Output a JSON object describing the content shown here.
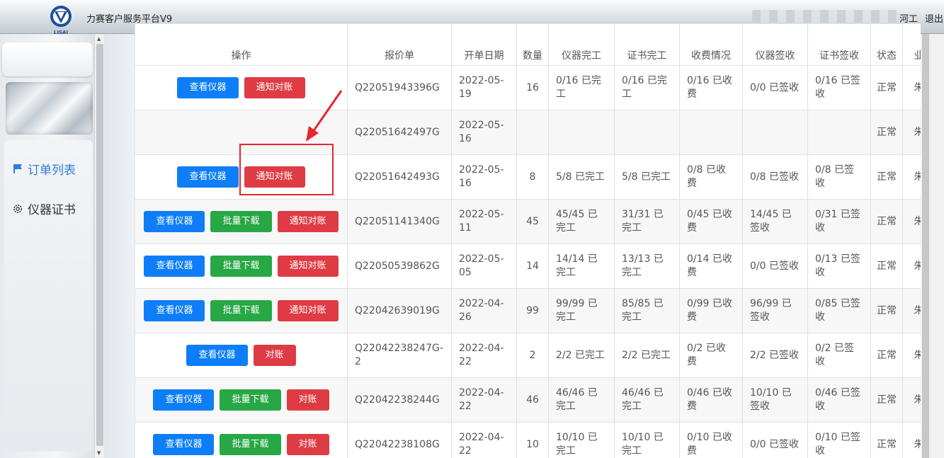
{
  "app": {
    "title": "力赛客户服务平台V9",
    "logo_text": "LISAI",
    "user_name_suffix": "河工",
    "logout_label": "退出"
  },
  "sidebar": {
    "items": [
      {
        "label": "订单列表",
        "icon": "flag-icon",
        "active": true
      },
      {
        "label": "仪器证书",
        "icon": "gear-icon",
        "active": false
      }
    ]
  },
  "table": {
    "headers": [
      "操作",
      "报价单",
      "开单日期",
      "数量",
      "仪器完工",
      "证书完工",
      "收费情况",
      "仪器签收",
      "证书签收",
      "状态",
      "业"
    ],
    "rows": [
      {
        "buttons": [
          {
            "label": "查看仪器",
            "color": "blue"
          },
          {
            "label": "通知对账",
            "color": "red"
          }
        ],
        "quote": "Q22051943396G",
        "date": "2022-05-19",
        "qty": "16",
        "inst_done": "0/16 已完工",
        "cert_done": "0/16 已完工",
        "fee": "0/16 已收费",
        "inst_sign": "0/0 已签收",
        "cert_sign": "0/16 已签收",
        "status": "正常",
        "extra": "朱"
      },
      {
        "buttons": [],
        "quote": "Q22051642497G",
        "date": "2022-05-16",
        "qty": "",
        "inst_done": "",
        "cert_done": "",
        "fee": "",
        "inst_sign": "",
        "cert_sign": "",
        "status": "正常",
        "extra": "朱"
      },
      {
        "buttons": [
          {
            "label": "查看仪器",
            "color": "blue"
          },
          {
            "label": "通知对账",
            "color": "red"
          }
        ],
        "quote": "Q22051642493G",
        "date": "2022-05-16",
        "qty": "8",
        "inst_done": "5/8 已完工",
        "cert_done": "5/8 已完工",
        "fee": "0/8 已收费",
        "inst_sign": "0/8 已签收",
        "cert_sign": "0/8 已签收",
        "status": "正常",
        "extra": "朱"
      },
      {
        "buttons": [
          {
            "label": "查看仪器",
            "color": "blue"
          },
          {
            "label": "批量下载",
            "color": "green"
          },
          {
            "label": "通知对账",
            "color": "red"
          }
        ],
        "quote": "Q22051141340G",
        "date": "2022-05-11",
        "qty": "45",
        "inst_done": "45/45 已完工",
        "cert_done": "31/31 已完工",
        "fee": "0/45 已收费",
        "inst_sign": "14/45 已签收",
        "cert_sign": "0/31 已签收",
        "status": "正常",
        "extra": "朱"
      },
      {
        "buttons": [
          {
            "label": "查看仪器",
            "color": "blue"
          },
          {
            "label": "批量下载",
            "color": "green"
          },
          {
            "label": "通知对账",
            "color": "red"
          }
        ],
        "quote": "Q22050539862G",
        "date": "2022-05-05",
        "qty": "14",
        "inst_done": "14/14 已完工",
        "cert_done": "13/13 已完工",
        "fee": "0/14 已收费",
        "inst_sign": "0/0 已签收",
        "cert_sign": "0/13 已签收",
        "status": "正常",
        "extra": "朱"
      },
      {
        "buttons": [
          {
            "label": "查看仪器",
            "color": "blue"
          },
          {
            "label": "批量下载",
            "color": "green"
          },
          {
            "label": "通知对账",
            "color": "red"
          }
        ],
        "quote": "Q22042639019G",
        "date": "2022-04-26",
        "qty": "99",
        "inst_done": "99/99 已完工",
        "cert_done": "85/85 已完工",
        "fee": "0/99 已收费",
        "inst_sign": "96/99 已签收",
        "cert_sign": "0/85 已签收",
        "status": "正常",
        "extra": "朱"
      },
      {
        "buttons": [
          {
            "label": "查看仪器",
            "color": "blue"
          },
          {
            "label": "对账",
            "color": "red"
          }
        ],
        "quote": "Q22042238247G-2",
        "date": "2022-04-22",
        "qty": "2",
        "inst_done": "2/2 已完工",
        "cert_done": "2/2 已完工",
        "fee": "0/2 已收费",
        "inst_sign": "2/2 已签收",
        "cert_sign": "0/2 已签收",
        "status": "正常",
        "extra": "朱"
      },
      {
        "buttons": [
          {
            "label": "查看仪器",
            "color": "blue"
          },
          {
            "label": "批量下载",
            "color": "green"
          },
          {
            "label": "对账",
            "color": "red"
          }
        ],
        "quote": "Q22042238244G",
        "date": "2022-04-22",
        "qty": "46",
        "inst_done": "46/46 已完工",
        "cert_done": "46/46 已完工",
        "fee": "0/46 已收费",
        "inst_sign": "10/10 已签收",
        "cert_sign": "0/46 已签收",
        "status": "正常",
        "extra": "朱"
      },
      {
        "buttons": [
          {
            "label": "查看仪器",
            "color": "blue"
          },
          {
            "label": "批量下载",
            "color": "green"
          },
          {
            "label": "对账",
            "color": "red"
          }
        ],
        "quote": "Q22042238108G",
        "date": "2022-04-22",
        "qty": "10",
        "inst_done": "10/10 已完工",
        "cert_done": "10/10 已完工",
        "fee": "0/10 已收费",
        "inst_sign": "0/0 已签收",
        "cert_sign": "0/10 已签收",
        "status": "正常",
        "extra": "朱"
      }
    ]
  },
  "colors": {
    "blue": "#0d7ef7",
    "green": "#28a745",
    "red": "#df3b44",
    "annotation": "#e8252d",
    "nav_active": "#2f7fd8"
  }
}
